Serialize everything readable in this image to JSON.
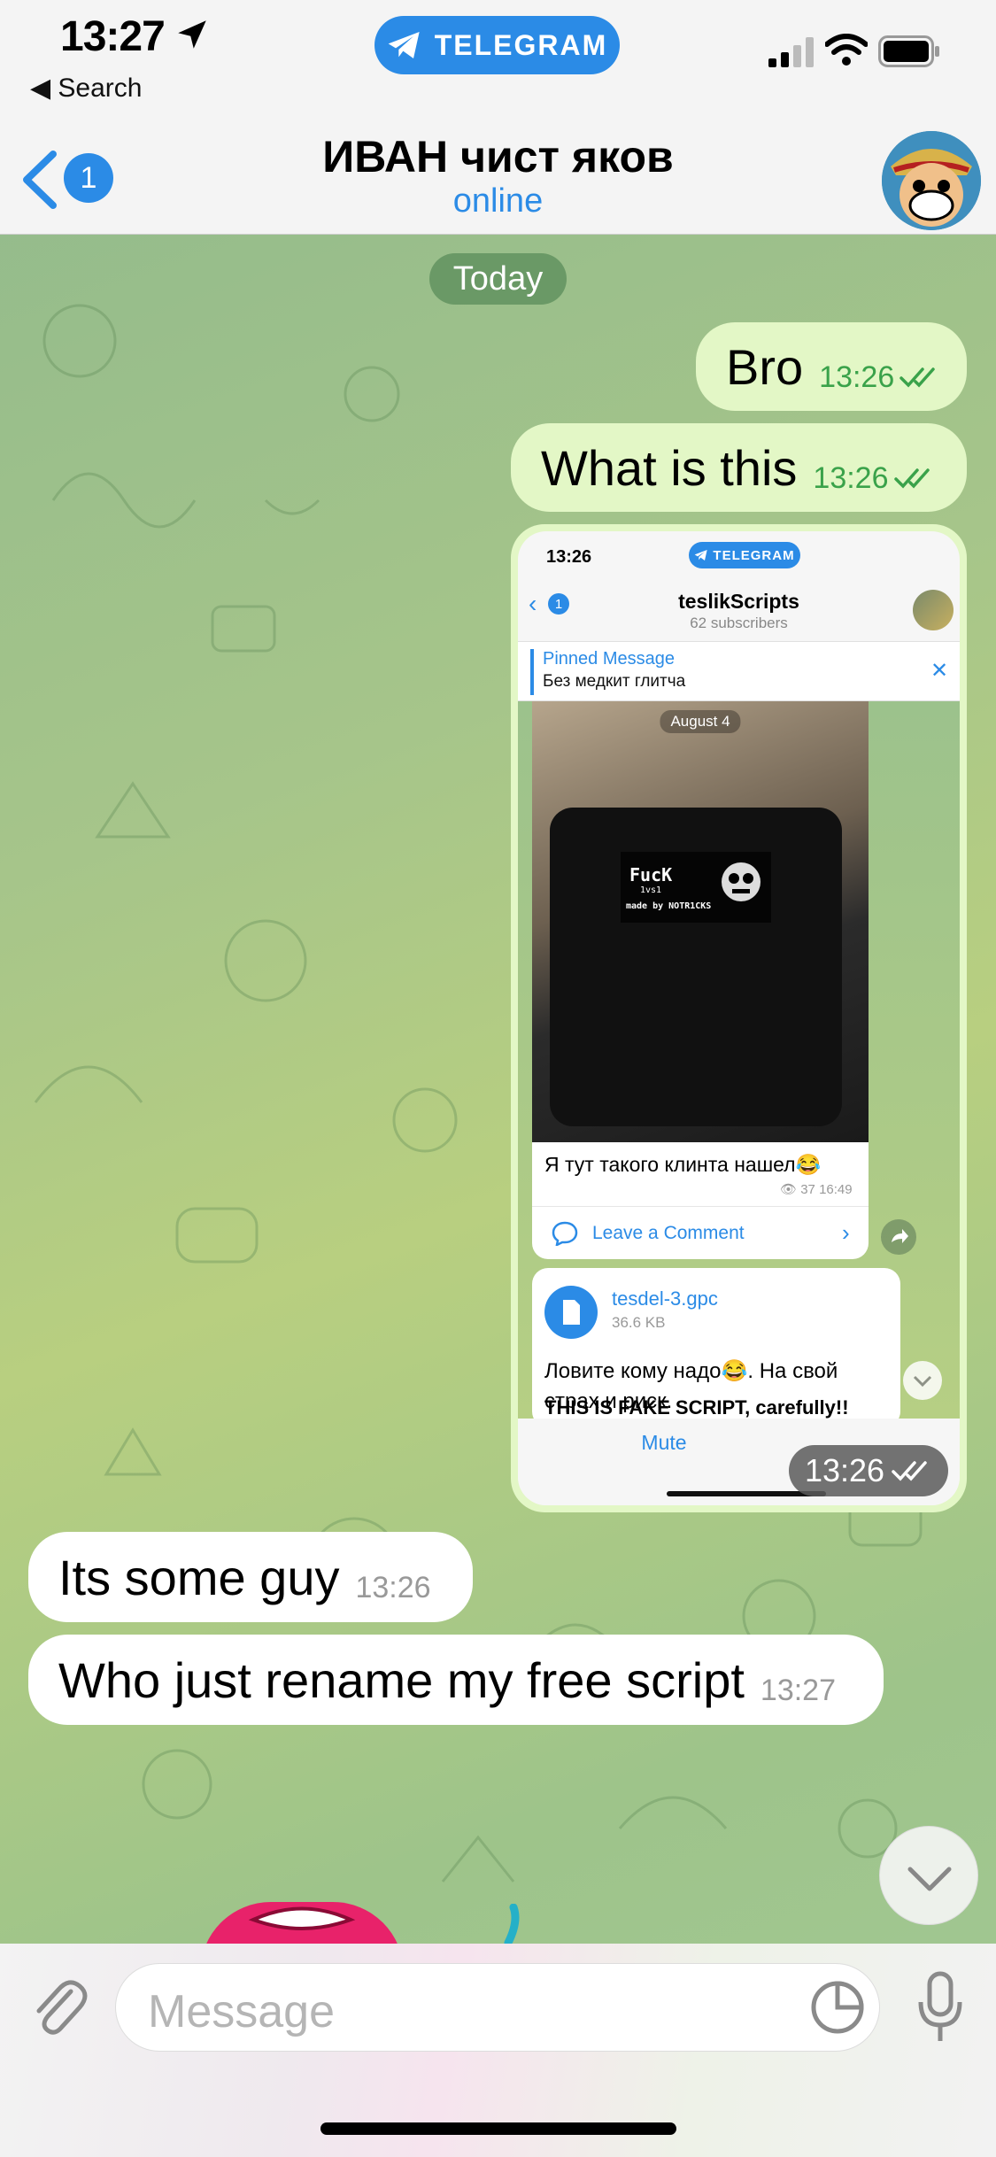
{
  "status_bar": {
    "time": "13:27",
    "back_app": "◀ Search",
    "app_pill": "TELEGRAM"
  },
  "nav": {
    "back_badge": "1",
    "title": "ИВАН чист яков",
    "subtitle": "online"
  },
  "chat": {
    "date_label": "Today",
    "messages": [
      {
        "direction": "out",
        "text": "Bro",
        "time": "13:26",
        "read": true
      },
      {
        "direction": "out",
        "text": "What is this",
        "time": "13:26",
        "read": true
      },
      {
        "direction": "out",
        "type": "screenshot",
        "time": "13:26",
        "read": true
      },
      {
        "direction": "in",
        "text": "Its some guy",
        "time": "13:26"
      },
      {
        "direction": "in",
        "text": "Who just rename my free script",
        "time": "13:27"
      }
    ]
  },
  "screenshot": {
    "time": "13:26",
    "app_pill": "TELEGRAM",
    "back_badge": "1",
    "channel_title": "teslikScripts",
    "channel_sub": "62 subscribers",
    "pinned_title": "Pinned Message",
    "pinned_text": "Без медкит глитча",
    "date_label": "August 4",
    "device_screen_line1": "FucK",
    "device_screen_line2": "1vs1",
    "device_screen_line3": "made by NOTR1CKS",
    "caption": "Я тут такого клинта нашел😂",
    "views": "37 16:49",
    "comment_label": "Leave a Comment",
    "file_name": "tesdel-3.gpc",
    "file_size": "36.6 KB",
    "file_text": "Ловите кому надо😂. На свой страх и риск.",
    "file_warning": "THIS IS FAKE SCRIPT, carefully!!",
    "mute_label": "Mute"
  },
  "input": {
    "placeholder": "Message"
  },
  "colors": {
    "accent": "#2b8be6",
    "outgoing_bubble": "#e3f7c6",
    "incoming_bubble": "#ffffff",
    "read_check": "#3aa24a"
  },
  "icons": [
    "location-arrow-icon",
    "telegram-plane-icon",
    "signal-icon",
    "wifi-icon",
    "battery-icon",
    "back-chevron-icon",
    "avatar",
    "double-check-icon",
    "attach-paperclip-icon",
    "sticker-icon",
    "microphone-icon",
    "scroll-down-chevron-icon"
  ]
}
